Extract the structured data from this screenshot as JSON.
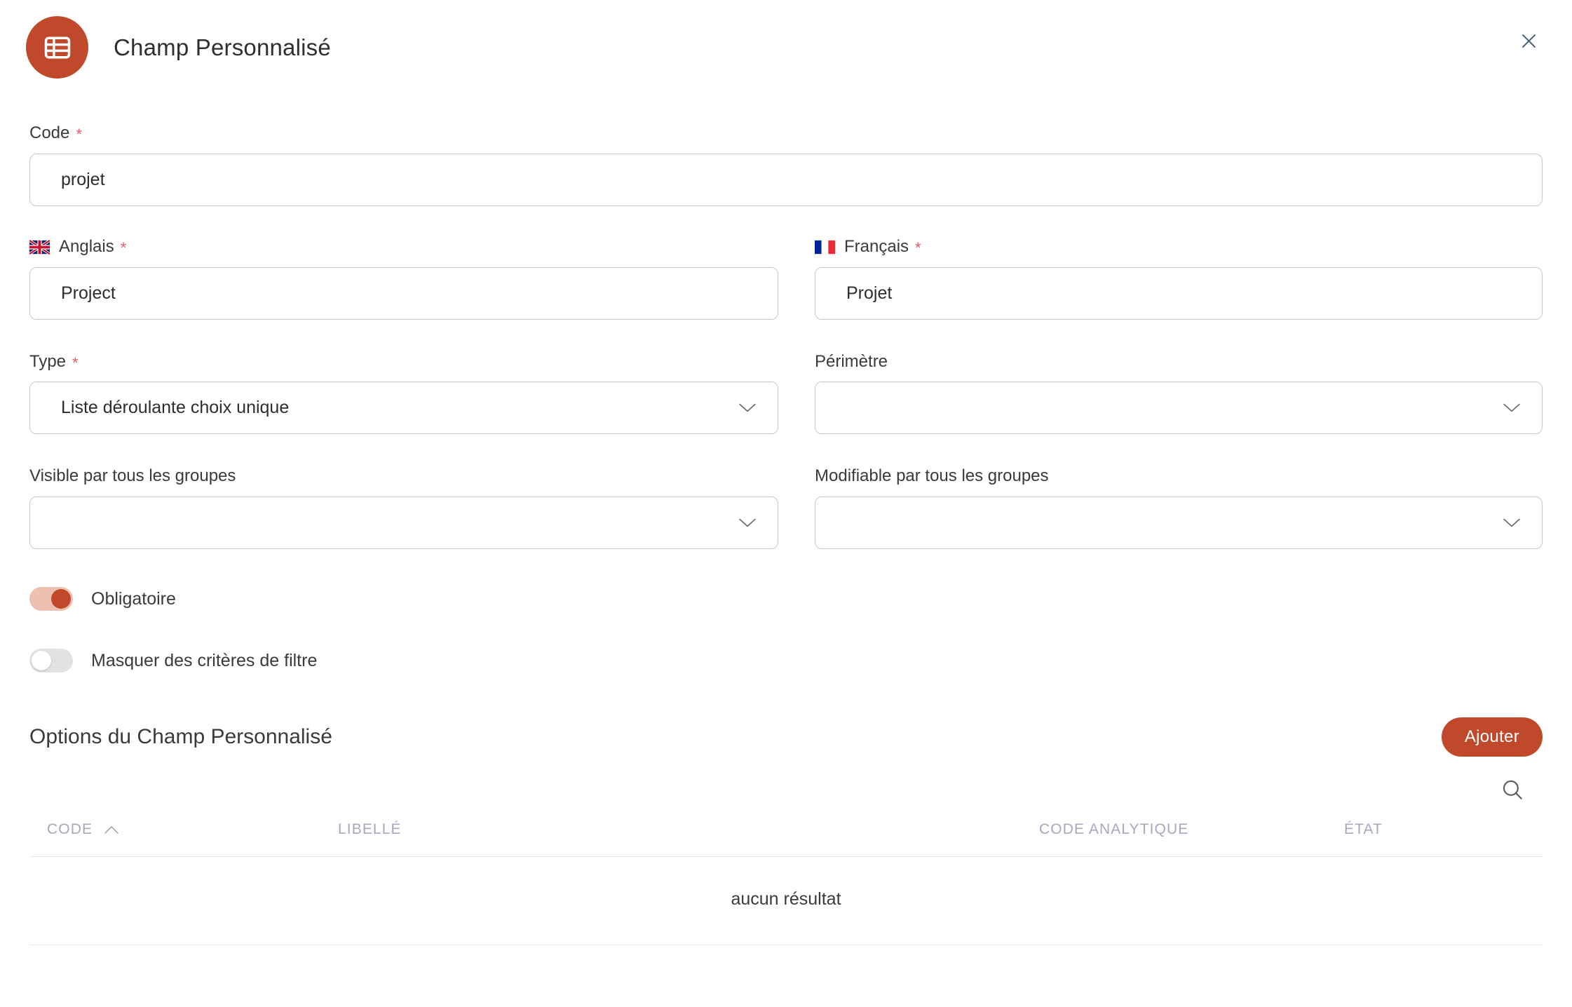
{
  "header": {
    "title": "Champ Personnalisé",
    "icon": "table-icon",
    "close_icon": "close-icon",
    "accent_color": "#c0492b"
  },
  "form": {
    "code": {
      "label": "Code",
      "required_mark": "*",
      "value": "projet",
      "placeholder": ""
    },
    "english": {
      "label": "Anglais",
      "required_mark": "*",
      "flag_icon": "uk-flag-icon",
      "value": "Project",
      "placeholder": ""
    },
    "french": {
      "label": "Français",
      "required_mark": "*",
      "flag_icon": "fr-flag-icon",
      "value": "Projet",
      "placeholder": ""
    },
    "type": {
      "label": "Type",
      "required_mark": "*",
      "value": "Liste déroulante choix unique",
      "chevron_icon": "chevron-down-icon"
    },
    "perimeter": {
      "label": "Périmètre",
      "value": "",
      "chevron_icon": "chevron-down-icon"
    },
    "visible_all_groups": {
      "label": "Visible par tous les groupes",
      "value": "",
      "chevron_icon": "chevron-down-icon"
    },
    "editable_all_groups": {
      "label": "Modifiable par tous les groupes",
      "value": "",
      "chevron_icon": "chevron-down-icon"
    },
    "required_toggle": {
      "label": "Obligatoire",
      "state": "on"
    },
    "hide_filter_toggle": {
      "label": "Masquer des critères de filtre",
      "state": "off"
    }
  },
  "options_section": {
    "title": "Options du Champ Personnalisé",
    "add_button": "Ajouter",
    "search_icon": "search-icon",
    "table": {
      "columns": [
        {
          "label": "CODE",
          "sort_icon": "chevron-up-icon"
        },
        {
          "label": "LIBELLÉ",
          "sort_icon": ""
        },
        {
          "label": "CODE ANALYTIQUE",
          "sort_icon": ""
        },
        {
          "label": "ÉTAT",
          "sort_icon": ""
        }
      ],
      "rows": [],
      "empty_message": "aucun résultat"
    }
  }
}
